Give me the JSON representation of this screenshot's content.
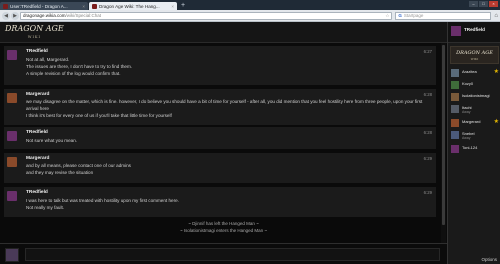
{
  "browser": {
    "tabs": [
      {
        "title": "User:TRedfield - Dragon A...",
        "close": "×",
        "active": false
      },
      {
        "title": "Dragon Age Wiki: The Hang...",
        "close": "×",
        "active": true
      }
    ],
    "new_tab": "+",
    "url_host": "dragonage.wikia.com",
    "url_path": "/wiki/Special:Chat",
    "search_placeholder": "Startpage",
    "search_engine": "G"
  },
  "chat": {
    "logo": "DRAGON AGE",
    "logo_sub": "WIKI",
    "messages": [
      {
        "user": "TRedfield",
        "time": "6:27",
        "avatar_color": "#6a2f6b",
        "lines": [
          "Not at all, Margerard.",
          "The issues are there, I don't have to try to find them.",
          "A simple revision of the log would confirm that."
        ]
      },
      {
        "user": "Margerard",
        "time": "6:28",
        "avatar_color": "#8a4a2a",
        "lines": [
          "we may disagree on the matter, which is fine. however, I do believe you should have a bit of time for yourself - after all, you did mention that you feel hostility here from three people, upon your first arrival here",
          "I think it's best for every one of us if you'll take that little time for yourself"
        ]
      },
      {
        "user": "TRedfield",
        "time": "6:28",
        "avatar_color": "#6a2f6b",
        "lines": [
          "Not sure what you mean."
        ]
      },
      {
        "user": "Margerard",
        "time": "6:29",
        "avatar_color": "#8a4a2a",
        "lines": [
          "and by all means, please contact one of our admins",
          "and they may revise the situation"
        ]
      },
      {
        "user": "TRedfield",
        "time": "6:29",
        "avatar_color": "#6a2f6b",
        "lines": [
          "I was here to talk but was treated with hostility upon my first comment here.",
          "Not really my fault."
        ]
      }
    ],
    "inline_alerts": [
      "~ Djinnif has left the Hanged Man ~",
      "~ Isolationistmagi enters the Hanged Man ~"
    ]
  },
  "sidebar": {
    "me": "TRedfield",
    "room_logo": "DRAGON AGE",
    "room_logo_sub": "WIKI",
    "users": [
      {
        "name": "Arazitea",
        "status": "",
        "color": "#5a6b7a",
        "star": true
      },
      {
        "name": "Kozy0",
        "status": "",
        "color": "#3f6b3a",
        "star": false
      },
      {
        "name": "Isolationistmagi",
        "status": "",
        "color": "#7a5a3a",
        "star": false
      },
      {
        "name": "Itachi",
        "status": "Away",
        "color": "#555b66",
        "star": false
      },
      {
        "name": "Margerard",
        "status": "",
        "color": "#8a4a2a",
        "star": true
      },
      {
        "name": "Snebel",
        "status": "Away",
        "color": "#4b5a7a",
        "star": false
      },
      {
        "name": "Toni-124",
        "status": "",
        "color": "#6a2f6b",
        "star": false
      }
    ],
    "options": "Options"
  },
  "colors": {
    "accent": "#e6b800",
    "background": "#0a0a0a",
    "message_bg": "#1b1b1b"
  }
}
